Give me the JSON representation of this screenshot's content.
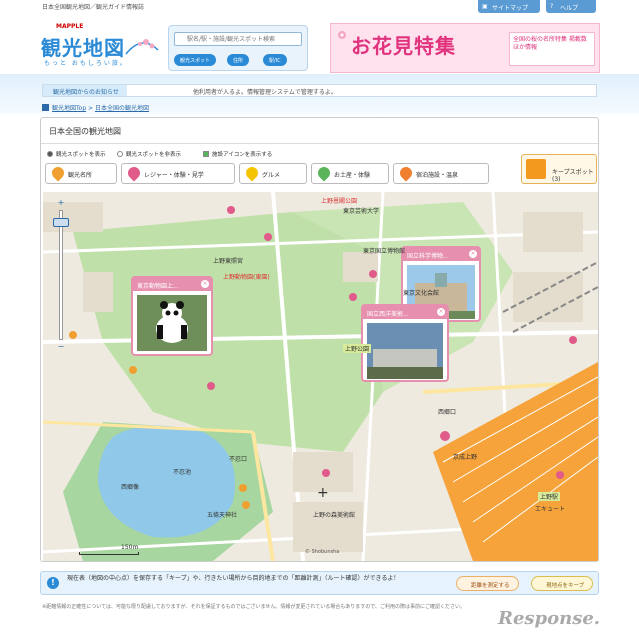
{
  "top": {
    "site_text": "日本全国観光地図／観光ガイド情報誌",
    "sitemap_label": "サイトマップ",
    "help_label": "ヘルプ"
  },
  "logo": {
    "brand": "MAPPLE",
    "title": "観光地図",
    "tagline": "もっと おもしろい旅。"
  },
  "search": {
    "placeholder": "駅名/駅・施設/観光スポット検索",
    "buttons": [
      "観光スポット",
      "住所",
      "駅/IC"
    ]
  },
  "banner": {
    "title": "お花見特集",
    "side_text": "全国の桜の名所特集 掲載数 ほか情報"
  },
  "notice": {
    "label": "観光地図からのお知らせ",
    "text": "他利用者が入るよ。情報管理システムで管理するよ。"
  },
  "breadcrumb": [
    "観光地図Top",
    "日本全国の観光地図"
  ],
  "panel": {
    "title": "日本全国の観光地図",
    "options": [
      {
        "label": "観光スポットを表示",
        "type": "radio",
        "on": true
      },
      {
        "label": "観光スポットを非表示",
        "type": "radio",
        "on": false
      },
      {
        "label": "施設アイコンを表示する",
        "type": "check",
        "on": true
      }
    ],
    "categories": [
      {
        "label": "観光名所",
        "color": "#f0a030"
      },
      {
        "label": "レジャー・体験・見学",
        "color": "#e05a8a"
      },
      {
        "label": "グルメ",
        "color": "#f5c400"
      },
      {
        "label": "お土産・体験",
        "color": "#5ab55a"
      },
      {
        "label": "宿泊施設・温泉",
        "color": "#f08030"
      }
    ],
    "keep_label": "キープスポット(3)"
  },
  "map": {
    "popups": [
      {
        "title": "東京動物園上..."
      },
      {
        "title": "国立科学博物..."
      },
      {
        "title": "国立西洋美術..."
      }
    ],
    "labels": [
      {
        "text": "上野恩賜公園",
        "style": "red"
      },
      {
        "text": "上野動物園(東園)",
        "style": "red"
      },
      {
        "text": "不忍池",
        "style": "plain"
      },
      {
        "text": "西郷像",
        "style": "plain"
      },
      {
        "text": "上野公園",
        "style": "hl"
      },
      {
        "text": "上野駅",
        "style": "hl"
      },
      {
        "text": "エキュート",
        "style": "plain"
      },
      {
        "text": "西郷口",
        "style": "plain"
      },
      {
        "text": "東京芸術大学",
        "style": "plain"
      },
      {
        "text": "東京国立博物館",
        "style": "plain"
      },
      {
        "text": "五條天神社",
        "style": "plain"
      },
      {
        "text": "不忍口",
        "style": "plain"
      },
      {
        "text": "京成上野",
        "style": "plain"
      },
      {
        "text": "上野の森美術館",
        "style": "plain"
      },
      {
        "text": "東京文化会館",
        "style": "plain"
      },
      {
        "text": "上野東照宮",
        "style": "plain"
      }
    ],
    "scale_label": "150m",
    "copyright": "© Shobunsha"
  },
  "bottom": {
    "text": "現在表（地図の中心点）を保存する「キープ」や、行きたい場所から目的地までの「距離計測」（ルート確認）ができるよ！",
    "button1": "距離を測定する",
    "button2": "現地点をキープ"
  },
  "footnote": "※距離情報の正確性については、可能な限り配慮しておりますが、それを保証するものではございません。情報が変更されている場合もありますので、ご利用の際は事前にご確認ください。",
  "watermark": "Response."
}
